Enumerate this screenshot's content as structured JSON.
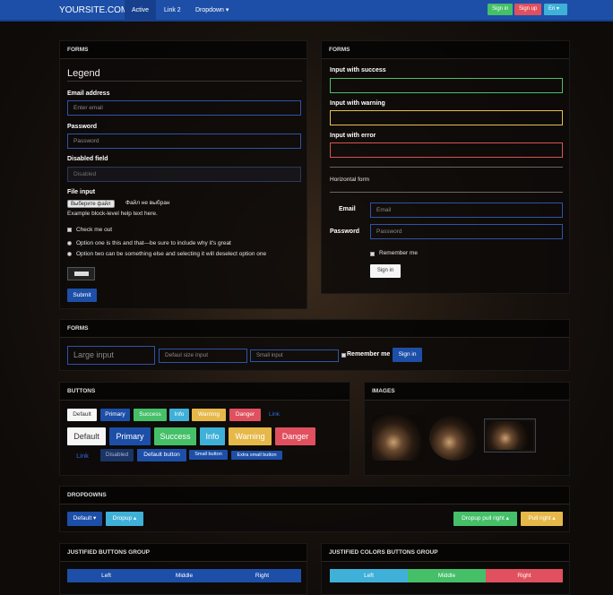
{
  "navbar": {
    "brand": "YOURSITE.COM",
    "items": [
      "Active",
      "Link 2",
      "Dropdown ▾"
    ],
    "sign_in": "Sign in",
    "sign_up": "Sign up",
    "lang": "En ▾"
  },
  "forms1": {
    "heading": "FORMS",
    "legend": "Legend",
    "email_label": "Email address",
    "email_placeholder": "Enter email",
    "password_label": "Password",
    "password_placeholder": "Password",
    "disabled_label": "Disabled field",
    "disabled_placeholder": "Disabled",
    "file_label": "File input",
    "file_button": "Выберите файл",
    "file_status": "Файл не выбран",
    "help_text": "Example block-level help text here.",
    "check_label": "Check me out",
    "radio1": "Option one is this and that—be sure to include why it's great",
    "radio2": "Option two can be something else and selecting it will deselect option one",
    "submit": "Submit"
  },
  "forms2": {
    "heading": "FORMS",
    "success_label": "Input with success",
    "warning_label": "Input with warning",
    "error_label": "Input with error",
    "horizontal_title": "Horizontal form",
    "email_label": "Email",
    "email_placeholder": "Email",
    "password_label": "Password",
    "password_placeholder": "Password",
    "remember": "Remember me",
    "sign_in": "Sign in"
  },
  "forms3": {
    "heading": "FORMS",
    "large_placeholder": "Large input",
    "default_placeholder": "Defaul size input",
    "small_placeholder": "Small input",
    "remember": "Remember me",
    "sign_in": "Sign in"
  },
  "buttons": {
    "heading": "BUTTONS",
    "row_labels": [
      "Default",
      "Primary",
      "Success",
      "Info",
      "Warning",
      "Danger",
      "Link"
    ],
    "disabled": "Disabled",
    "default_button": "Default button",
    "small_button": "Small button",
    "extra_small_button": "Extra small button"
  },
  "images": {
    "heading": "IMAGES"
  },
  "dropdowns": {
    "heading": "DROPDOWNS",
    "default": "Default ▾",
    "dropup": "Dropup ▴",
    "dropup_pull_right": "Dropup pull right ▴",
    "pull_right": "Pull right ▴"
  },
  "justified": {
    "heading": "JUSTIFIED BUTTONS GROUP",
    "left": "Left",
    "middle": "Middle",
    "right": "Right"
  },
  "justified_colors": {
    "heading": "JUSTIFIED COLORS BUTTONS GROUP",
    "left": "Left",
    "middle": "Middle",
    "right": "Right"
  },
  "colors": {
    "primary": "#1d4fa8",
    "success": "#45bf68",
    "info": "#3fb0d8",
    "warning": "#e6b84a",
    "danger": "#e0505e"
  }
}
